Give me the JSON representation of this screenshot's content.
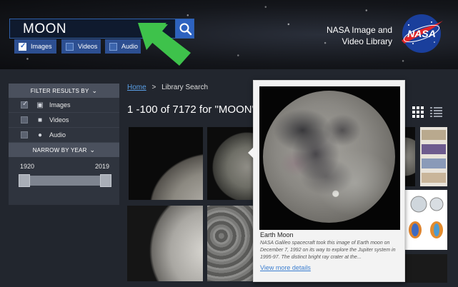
{
  "header": {
    "search_value": "MOON",
    "brand_line1": "NASA Image and",
    "brand_line2": "Video Library",
    "logo_text": "NASA",
    "filters": [
      {
        "label": "Images",
        "checked": true
      },
      {
        "label": "Videos",
        "checked": false
      },
      {
        "label": "Audio",
        "checked": false
      }
    ]
  },
  "sidebar": {
    "filter_title": "FILTER RESULTS BY",
    "media": [
      {
        "label": "Images",
        "checked": true,
        "icon": "image-icon"
      },
      {
        "label": "Videos",
        "checked": false,
        "icon": "video-icon"
      },
      {
        "label": "Audio",
        "checked": false,
        "icon": "microphone-icon"
      }
    ],
    "year_title": "NARROW BY YEAR",
    "year_min": "1920",
    "year_max": "2019"
  },
  "breadcrumb": {
    "home": "Home",
    "separator": ">",
    "current": "Library Search"
  },
  "results_text": "1 -100 of 7172 for \"MOON\"",
  "popup": {
    "title": "Earth Moon",
    "description": "NASA Galileo spacecraft took this image of Earth moon on December 7, 1992 on its way to explore the Jupiter system in 1995-97. The distinct bright ray crater at the...",
    "link": "View more details"
  },
  "colors": {
    "accent_blue": "#2d62c0",
    "arrow_green": "#3ec24b",
    "link_blue": "#5aa0e8"
  }
}
